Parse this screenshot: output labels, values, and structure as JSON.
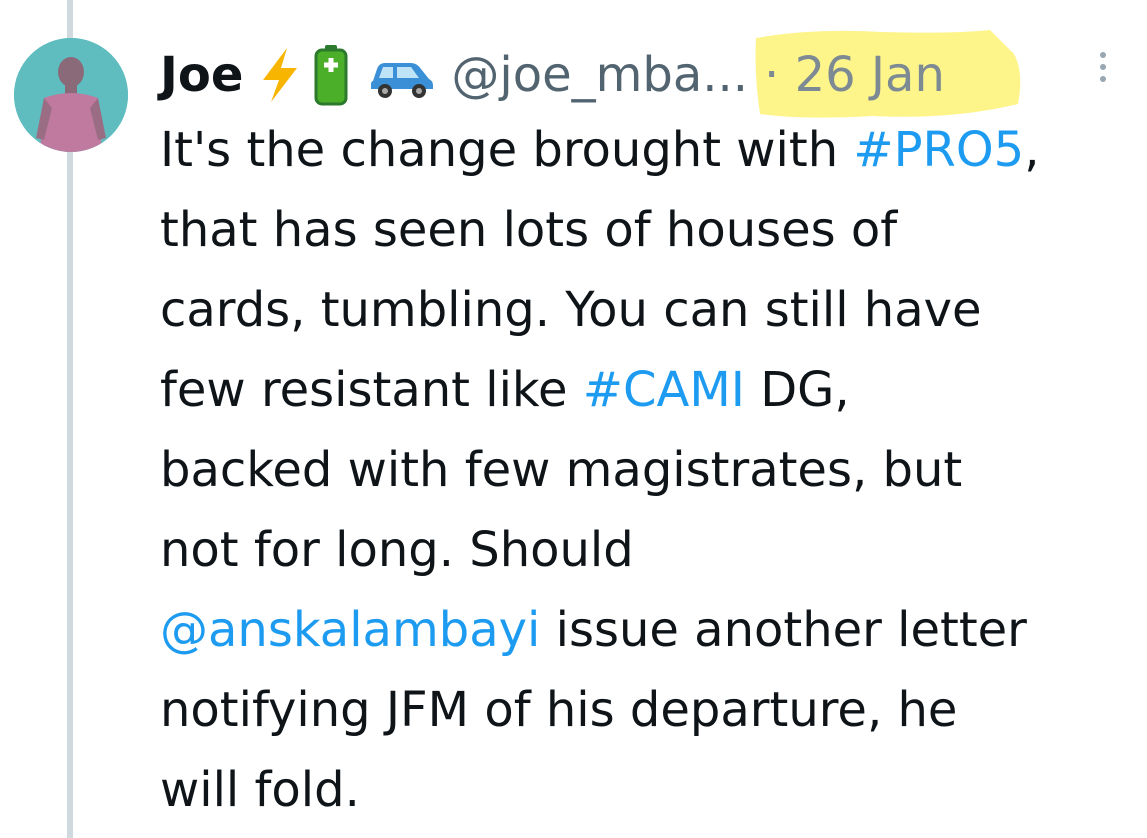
{
  "tweet": {
    "author_name": "Joe",
    "author_emojis": [
      "lightning-icon",
      "battery-icon",
      "car-icon"
    ],
    "handle": "@joe_mba...",
    "date": "· 26 Jan",
    "lines": [
      {
        "segments": [
          {
            "text": "It's the change brought with ",
            "type": "text"
          },
          {
            "text": "#PRO5",
            "type": "hashtag"
          },
          {
            "text": ",",
            "type": "text"
          }
        ]
      },
      {
        "segments": [
          {
            "text": "that has seen lots of houses of",
            "type": "text"
          }
        ]
      },
      {
        "segments": [
          {
            "text": "cards, tumbling. You can still have",
            "type": "text"
          }
        ]
      },
      {
        "segments": [
          {
            "text": "few resistant like ",
            "type": "text"
          },
          {
            "text": "#CAMI",
            "type": "hashtag"
          },
          {
            "text": " DG,",
            "type": "text"
          }
        ]
      },
      {
        "segments": [
          {
            "text": "backed with few magistrates, but",
            "type": "text"
          }
        ]
      },
      {
        "segments": [
          {
            "text": "not for long. Should",
            "type": "text"
          }
        ]
      },
      {
        "segments": [
          {
            "text": "@anskalambayi",
            "type": "mention"
          },
          {
            "text": " issue another letter",
            "type": "text"
          }
        ]
      },
      {
        "segments": [
          {
            "text": "notifying JFM of his departure, he",
            "type": "text"
          }
        ]
      },
      {
        "segments": [
          {
            "text": "will fold.",
            "type": "text"
          }
        ]
      }
    ]
  },
  "colors": {
    "link": "#1d9bf0",
    "text": "#0f1419",
    "secondary": "#536471",
    "highlight": "#fdf48a",
    "avatar_bg": "#5fbdc0"
  }
}
